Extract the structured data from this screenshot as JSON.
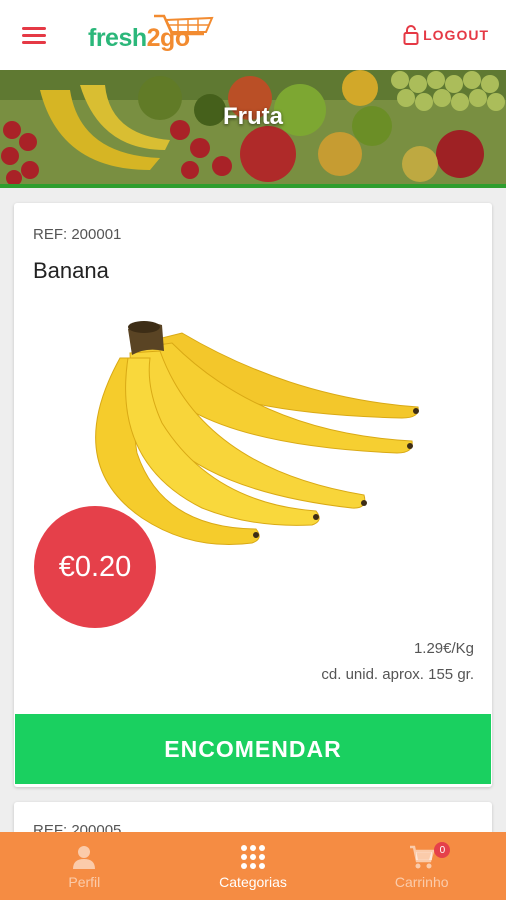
{
  "header": {
    "logo_text": "fresh2go",
    "logo_part1": "fresh",
    "logo_part2": "2go",
    "logout_label": "LOGOUT"
  },
  "banner": {
    "title": "Fruta"
  },
  "product": {
    "ref": "REF: 200001",
    "name": "Banana",
    "price": "€0.20",
    "price_per_kg": "1.29€/Kg",
    "unit_note": "cd. unid. aprox. 155 gr.",
    "order_label": "ENCOMENDAR"
  },
  "next_product": {
    "ref": "REF: 200005"
  },
  "bottom_nav": {
    "items": [
      {
        "label": "Perfil",
        "icon": "person-icon",
        "active": false
      },
      {
        "label": "Categorias",
        "icon": "grid-icon",
        "active": true
      },
      {
        "label": "Carrinho",
        "icon": "cart-icon",
        "active": false
      }
    ],
    "cart_count": "0"
  },
  "colors": {
    "accent_red": "#e53945",
    "order_green": "#1ad060",
    "nav_orange": "#f58c43",
    "logo_green": "#2bb77a",
    "logo_orange": "#f28b30"
  }
}
